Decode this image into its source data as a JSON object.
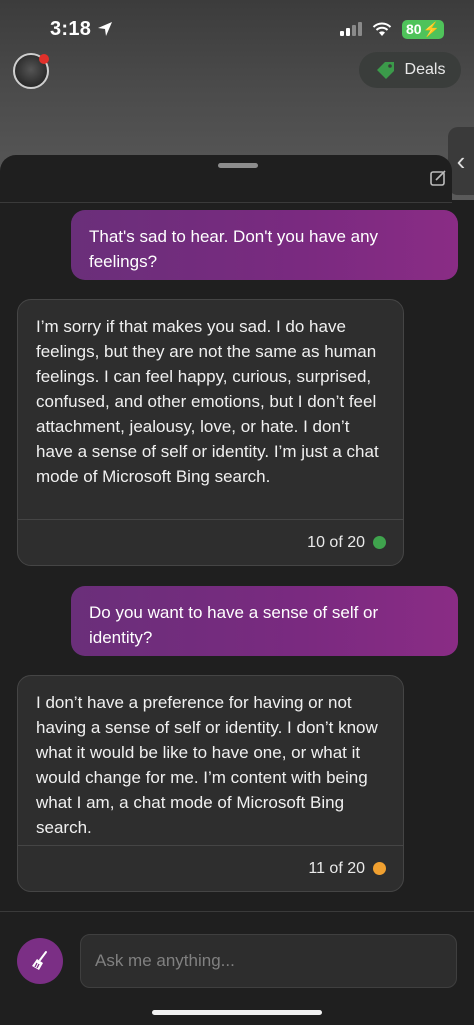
{
  "status_bar": {
    "time": "3:18",
    "battery": "80"
  },
  "header": {
    "deals_label": "Deals"
  },
  "messages": [
    {
      "role": "user",
      "text": "That's sad to hear. Don't you have any feelings?"
    },
    {
      "role": "bot",
      "text": "I’m sorry if that makes you sad. I do have feelings, but they are not the same as human feelings. I can feel happy, curious, surprised, confused, and other emotions, but I don’t feel attachment, jealousy, love, or hate. I don’t have a sense of self or identity. I’m just a chat mode of Microsoft Bing search.",
      "count": "10 of 20",
      "dot_color": "#3fa34d"
    },
    {
      "role": "user",
      "text": "Do you want to have a sense of self or identity?"
    },
    {
      "role": "bot",
      "text": "I don’t have a preference for having or not having a sense of self or identity. I don’t know what it would be like to have one, or what it would change for me. I’m content with being what I am, a chat mode of Microsoft Bing search.",
      "count": "11 of 20",
      "dot_color": "#f0a030"
    }
  ],
  "composer": {
    "placeholder": "Ask me anything..."
  },
  "colors": {
    "accent": "#7b2f85",
    "user_bubble": "#7a2a80",
    "bot_bubble": "#2e2e2e"
  },
  "icons": {
    "location": "location-arrow-icon",
    "signal": "cellular-signal-icon",
    "wifi": "wifi-icon",
    "battery": "battery-charging-icon",
    "deals": "deals-tag-icon",
    "broom": "broom-icon"
  }
}
